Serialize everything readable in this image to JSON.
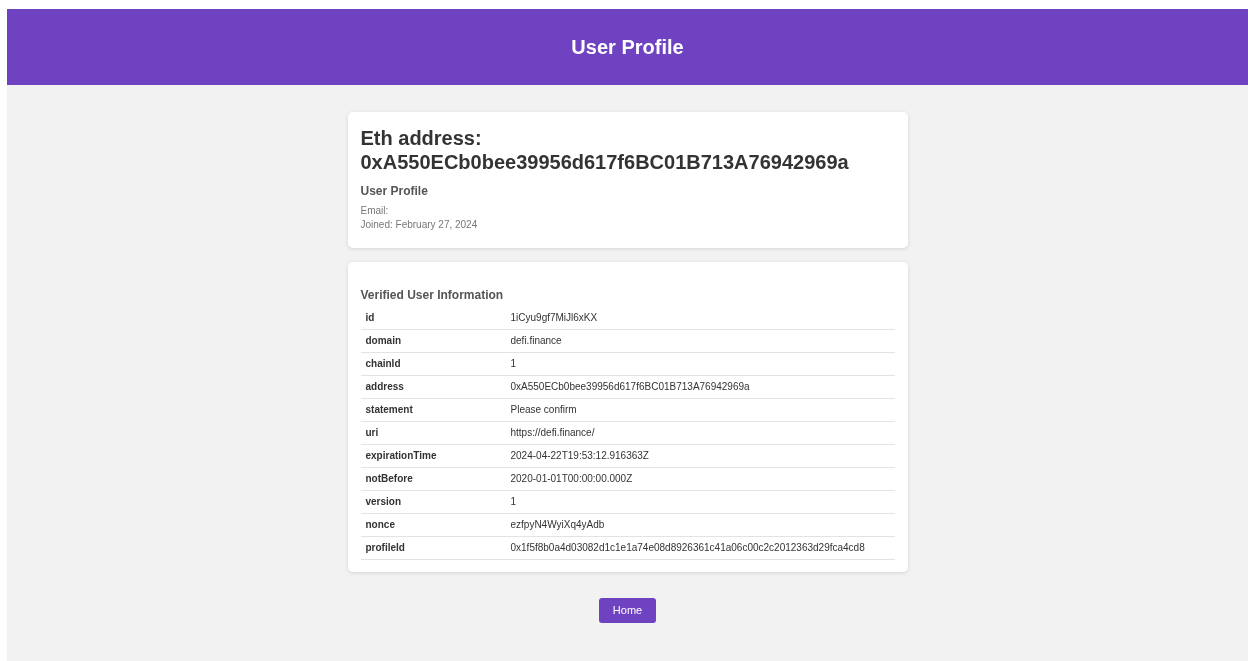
{
  "header": {
    "title": "User Profile"
  },
  "profile_card": {
    "heading_label": "Eth address:",
    "address": "0xA550ECb0bee39956d617f6BC01B713A76942969a",
    "subtitle": "User Profile",
    "email_label": "Email:",
    "joined": "Joined: February 27, 2024"
  },
  "verified_card": {
    "title": "Verified User Information",
    "rows": [
      {
        "key": "id",
        "value": "1iCyu9gf7MiJl6xKX"
      },
      {
        "key": "domain",
        "value": "defi.finance"
      },
      {
        "key": "chainId",
        "value": "1"
      },
      {
        "key": "address",
        "value": "0xA550ECb0bee39956d617f6BC01B713A76942969a"
      },
      {
        "key": "statement",
        "value": "Please confirm"
      },
      {
        "key": "uri",
        "value": "https://defi.finance/"
      },
      {
        "key": "expirationTime",
        "value": "2024-04-22T19:53:12.916363Z"
      },
      {
        "key": "notBefore",
        "value": "2020-01-01T00:00:00.000Z"
      },
      {
        "key": "version",
        "value": "1"
      },
      {
        "key": "nonce",
        "value": "ezfpyN4WyiXq4yAdb"
      },
      {
        "key": "profileId",
        "value": "0x1f5f8b0a4d03082d1c1e1a74e08d8926361c41a06c00c2c2012363d29fca4cd8"
      }
    ]
  },
  "buttons": [
    "Home"
  ]
}
